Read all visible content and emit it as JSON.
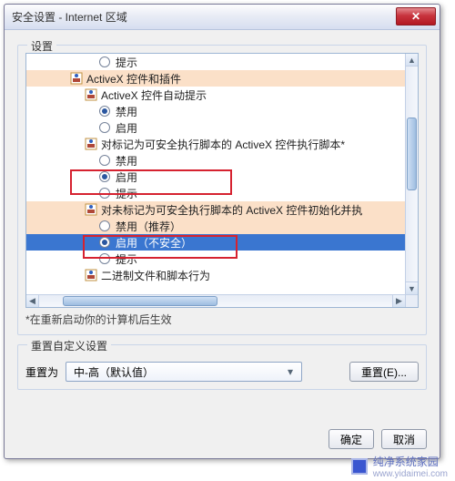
{
  "window": {
    "title": "安全设置 - Internet 区域",
    "close_glyph": "✕"
  },
  "settings": {
    "label": "设置",
    "restart_note": "*在重新启动你的计算机后生效",
    "rows": {
      "prompt_top": "提示",
      "section_activex": "ActiveX 控件和插件",
      "auto_prompt": "ActiveX 控件自动提示",
      "disable1": "禁用",
      "enable1": "启用",
      "safe_scripting": "对标记为可安全执行脚本的 ActiveX 控件执行脚本*",
      "disable2": "禁用",
      "enable2": "启用",
      "prompt2": "提示",
      "unsafe_scripting": "对未标记为可安全执行脚本的 ActiveX 控件初始化并执",
      "disable3": "禁用（推荐）",
      "enable3": "启用（不安全）",
      "prompt3": "提示",
      "binary": "二进制文件和脚本行为"
    }
  },
  "reset": {
    "group_label": "重置自定义设置",
    "label": "重置为",
    "combo_value": "中-高（默认值）",
    "reset_btn": "重置(E)..."
  },
  "footer": {
    "ok": "确定",
    "cancel": "取消"
  },
  "watermark": {
    "name": "纯净系统家园",
    "url": "www.yidaimei.com"
  },
  "colors": {
    "highlight": "#fbe0c8",
    "selected": "#3a76d0"
  }
}
